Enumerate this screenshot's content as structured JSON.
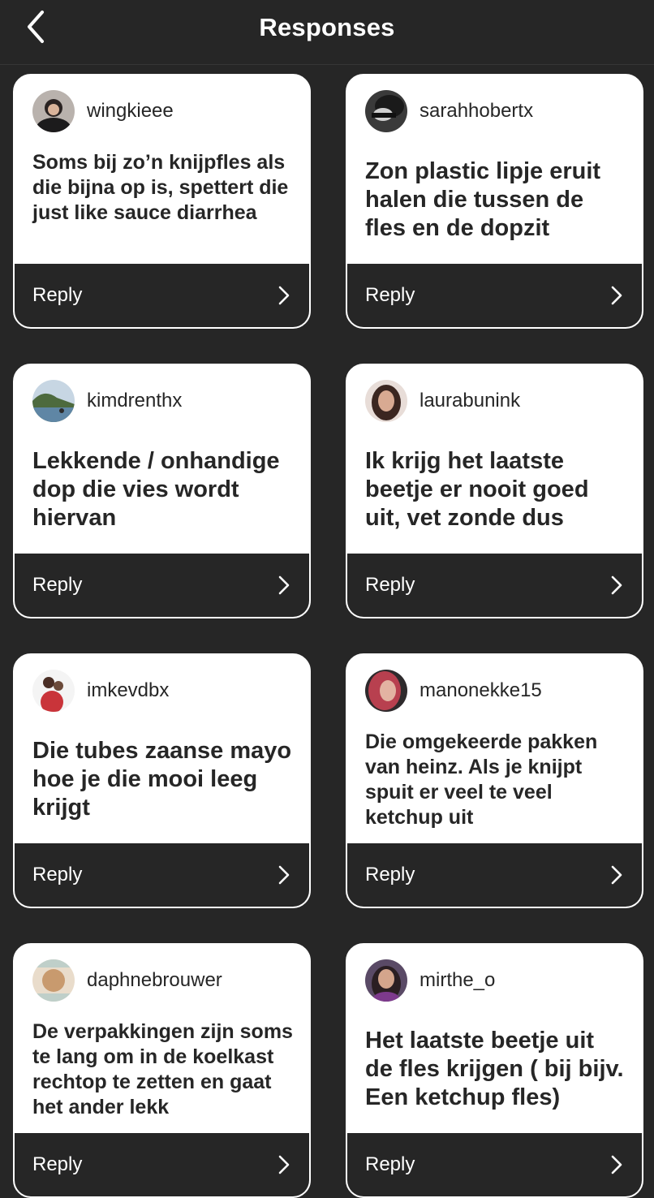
{
  "header": {
    "title": "Responses",
    "back_icon": "chevron-left-icon"
  },
  "reply_label": "Reply",
  "cards": [
    {
      "username": "wingkieee",
      "text": "Soms bij zo’n knijpfles als die bijna op is, spettert die just like sauce diarrhea"
    },
    {
      "username": "sarahhobertx",
      "text": "Zon plastic lipje eruit halen die tussen de fles en de dopzit"
    },
    {
      "username": "kimdrenthx",
      "text": "Lekkende / onhandige dop die vies wordt hiervan"
    },
    {
      "username": "laurabunink",
      "text": "Ik krijg het laatste beetje er nooit goed uit, vet zonde dus"
    },
    {
      "username": "imkevdbx",
      "text": "Die tubes zaanse mayo hoe je die mooi leeg krijgt"
    },
    {
      "username": "manonekke15",
      "text": "Die omgekeerde pakken van heinz. Als je knijpt spuit er veel te veel ketchup uit"
    },
    {
      "username": "daphnebrouwer",
      "text": "De verpakkingen zijn soms te lang om in de koelkast rechtop te zetten en gaat het ander lekk"
    },
    {
      "username": "mirthe_o",
      "text": "Het laatste beetje uit de fles krijgen ( bij bijv. Een ketchup fles)"
    }
  ]
}
